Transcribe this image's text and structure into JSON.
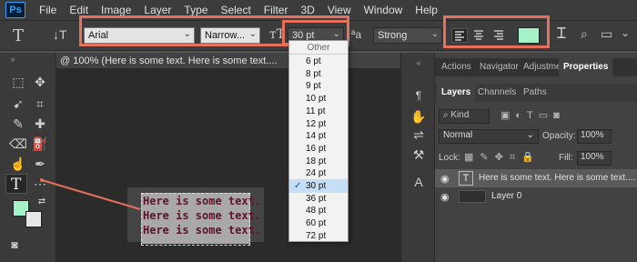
{
  "app": {
    "logo": "Ps"
  },
  "menu": [
    "File",
    "Edit",
    "Image",
    "Layer",
    "Type",
    "Select",
    "Filter",
    "3D",
    "View",
    "Window",
    "Help"
  ],
  "options": {
    "font_family": "Arial",
    "font_style": "Narrow...",
    "font_size": "30 pt",
    "aa_label": "ªa",
    "antialias": "Strong",
    "text_color": "#a6f2c8"
  },
  "font_size_menu": {
    "header": "Other",
    "items": [
      "6 pt",
      "8 pt",
      "9 pt",
      "10 pt",
      "11 pt",
      "12 pt",
      "14 pt",
      "16 pt",
      "18 pt",
      "24 pt",
      "30 pt",
      "36 pt",
      "48 pt",
      "60 pt",
      "72 pt"
    ],
    "selected": "30 pt"
  },
  "document": {
    "tab_title": "@ 100% (Here is some text. Here is some text....",
    "lines": [
      "Here is some text.",
      "Here is some text.",
      "Here is some text."
    ]
  },
  "panels": {
    "top_tabs": [
      "Actions",
      "Navigator",
      "Adjustmen",
      "Properties"
    ],
    "sub_tabs": [
      "Layers",
      "Channels",
      "Paths"
    ],
    "filter_kind": "Kind",
    "blend_mode": "Normal",
    "opacity_label": "Opacity:",
    "opacity_value": "100%",
    "lock_label": "Lock:",
    "fill_label": "Fill:",
    "fill_value": "100%",
    "layers": [
      {
        "name": "Here is some text. Here is some text....",
        "type": "T"
      },
      {
        "name": "Layer 0",
        "type": ""
      }
    ]
  },
  "colors": {
    "foreground": "#a6f2c8",
    "background": "#e8e8e8",
    "highlight": "#e8705a"
  }
}
